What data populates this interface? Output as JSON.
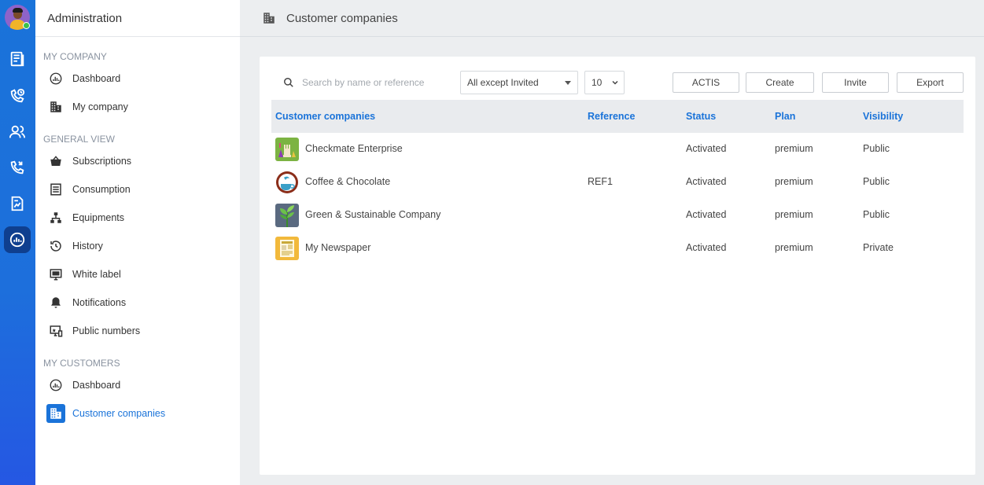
{
  "sidebar": {
    "title": "Administration",
    "sections": [
      {
        "label": "MY COMPANY",
        "items": [
          {
            "label": "Dashboard",
            "icon": "dashboard-gauge-icon"
          },
          {
            "label": "My company",
            "icon": "building-icon"
          }
        ]
      },
      {
        "label": "GENERAL VIEW",
        "items": [
          {
            "label": "Subscriptions",
            "icon": "basket-icon"
          },
          {
            "label": "Consumption",
            "icon": "receipt-icon"
          },
          {
            "label": "Equipments",
            "icon": "hierarchy-icon"
          },
          {
            "label": "History",
            "icon": "history-icon"
          },
          {
            "label": "White label",
            "icon": "monitor-icon"
          },
          {
            "label": "Notifications",
            "icon": "bell-icon"
          },
          {
            "label": "Public numbers",
            "icon": "public-numbers-icon"
          }
        ]
      },
      {
        "label": "MY CUSTOMERS",
        "items": [
          {
            "label": "Dashboard",
            "icon": "dashboard-gauge-icon"
          },
          {
            "label": "Customer companies",
            "icon": "building-icon",
            "active": true
          }
        ]
      }
    ]
  },
  "header": {
    "title": "Customer companies"
  },
  "toolbar": {
    "search_placeholder": "Search by name or reference",
    "filter_value": "All except Invited",
    "page_size": "10",
    "buttons": [
      "ACTIS",
      "Create",
      "Invite",
      "Export"
    ]
  },
  "table": {
    "columns": [
      "Customer companies",
      "Reference",
      "Status",
      "Plan",
      "Visibility"
    ],
    "rows": [
      {
        "name": "Checkmate Enterprise",
        "reference": "",
        "status": "Activated",
        "plan": "premium",
        "visibility": "Public",
        "logo": "chess-logo"
      },
      {
        "name": "Coffee & Chocolate",
        "reference": "REF1",
        "status": "Activated",
        "plan": "premium",
        "visibility": "Public",
        "logo": "coffee-logo"
      },
      {
        "name": "Green & Sustainable Company",
        "reference": "",
        "status": "Activated",
        "plan": "premium",
        "visibility": "Public",
        "logo": "plant-logo"
      },
      {
        "name": "My Newspaper",
        "reference": "",
        "status": "Activated",
        "plan": "premium",
        "visibility": "Private",
        "logo": "newspaper-logo"
      }
    ]
  },
  "colors": {
    "accent": "#1a73d9",
    "rail_active": "#0f3f8f"
  }
}
